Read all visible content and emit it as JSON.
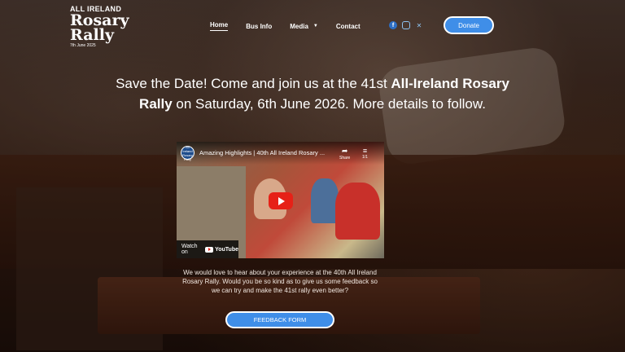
{
  "logo": {
    "line1": "ALL IRELAND",
    "line2": "Rosary",
    "line3": "Rally",
    "date": "7th June 2025"
  },
  "nav": {
    "items": [
      {
        "label": "Home",
        "active": true
      },
      {
        "label": "Bus Info"
      },
      {
        "label": "Media"
      },
      {
        "label": "Contact"
      }
    ]
  },
  "social": {
    "icons": [
      "facebook-icon",
      "instagram-icon",
      "x-icon"
    ],
    "accent": "#8ec3f0"
  },
  "donate_label": "Donate",
  "headline": {
    "part1": "Save the Date! Come and join us at the 41st ",
    "bold": "All-Ireland Rosary Rally",
    "part2": " on Saturday, 6th June 2026. More details to follow."
  },
  "video": {
    "channel_label": "All Ireland Rosary Rally",
    "title": "Amazing Highlights | 40th All Ireland Rosary ...",
    "share_label": "Share",
    "playlist_count": "1/1",
    "watch_on": "Watch on",
    "youtube": "YouTube"
  },
  "feedback": {
    "text": "We would love to hear about your experience at the 40th All Ireland Rosary Rally. Would you be so kind as to give us some feedback so we can try and make the 41st rally even better?",
    "button_label": "FEEDBACK FORM"
  },
  "colors": {
    "button": "#3f8ee8",
    "youtube_red": "#e62117"
  }
}
